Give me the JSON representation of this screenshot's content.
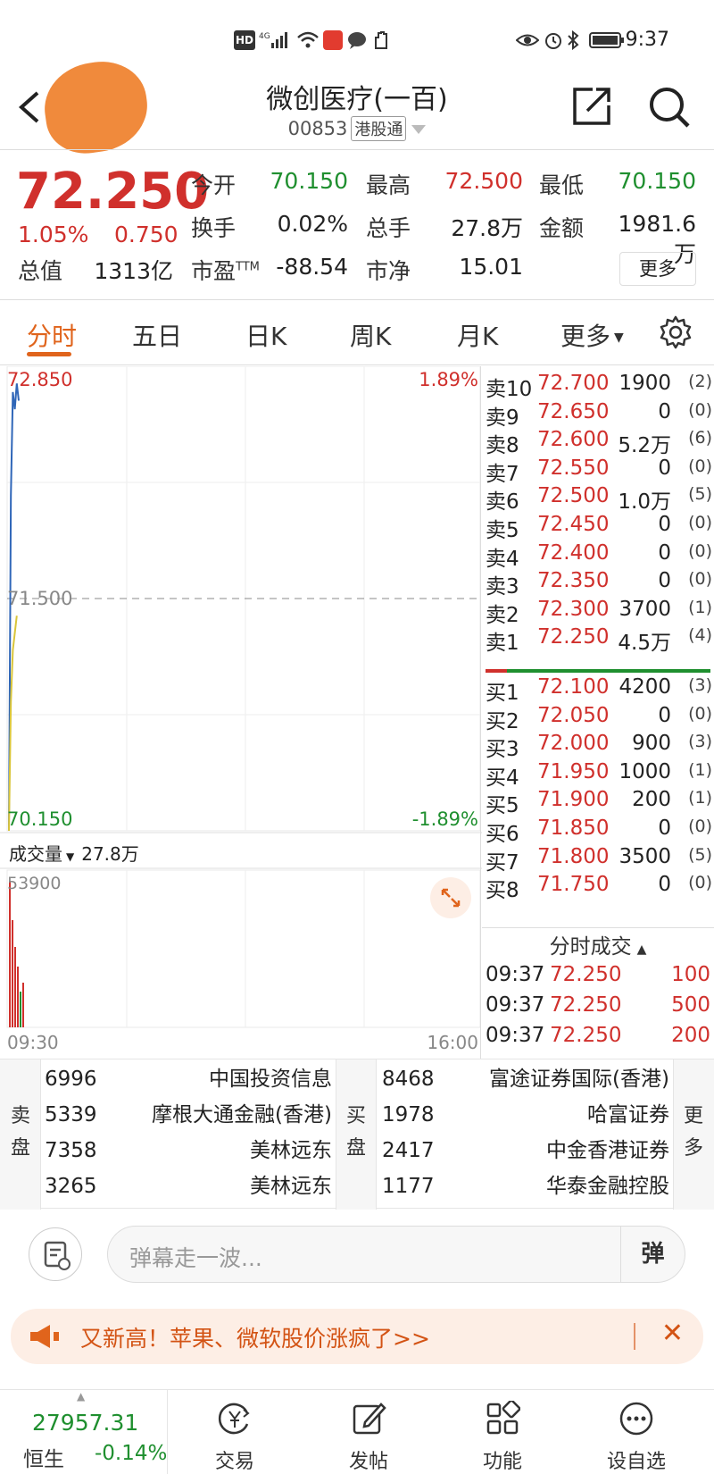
{
  "status_bar": {
    "time": "9:37",
    "network": "4G",
    "hd": "HD",
    "icons": [
      "hd-icon",
      "signal-icon",
      "wifi-icon",
      "app-icon",
      "chat-icon",
      "hand-icon",
      "eye-icon",
      "alarm-icon",
      "bluetooth-icon",
      "battery-icon"
    ]
  },
  "header": {
    "title": "微创医疗(一百)",
    "code": "00853",
    "tag": "港股通"
  },
  "quote": {
    "price": "72.250",
    "change_pct": "1.05%",
    "change_abs": "0.750",
    "labels": {
      "open": "今开",
      "high": "最高",
      "low": "最低",
      "turnover_rate": "换手",
      "volume": "总手",
      "amount": "金额",
      "market_cap": "总值",
      "pe": "市盈",
      "pe_sup": "TTM",
      "pb": "市净"
    },
    "values": {
      "open": "70.150",
      "high": "72.500",
      "low": "70.150",
      "turnover_rate": "0.02%",
      "volume": "27.8万",
      "amount": "1981.6万",
      "market_cap": "1313亿",
      "pe": "-88.54",
      "pb": "15.01"
    },
    "more_button": "更多"
  },
  "tabs": [
    {
      "label": "分时",
      "active": true
    },
    {
      "label": "五日"
    },
    {
      "label": "日K"
    },
    {
      "label": "周K"
    },
    {
      "label": "月K"
    },
    {
      "label": "更多"
    }
  ],
  "chart": {
    "y_top": "72.850",
    "y_mid": "71.500",
    "y_bottom": "70.150",
    "pct_top": "1.89%",
    "pct_bottom": "-1.89%",
    "volume_label": "成交量",
    "volume_value": "27.8万",
    "volume_max": "53900",
    "time_start": "09:30",
    "time_end": "16:00"
  },
  "chart_data": {
    "type": "line",
    "ylim": [
      70.15,
      72.85
    ],
    "reference": 71.5,
    "series": [
      {
        "values": [
          70.15,
          72.1,
          72.7,
          72.6,
          72.75,
          72.65
        ]
      },
      {
        "values": [
          70.15,
          70.9,
          71.2,
          71.3,
          71.4
        ]
      }
    ]
  },
  "order_book": {
    "asks": [
      {
        "label": "卖10",
        "price": "72.700",
        "qty": "1900",
        "count": "(2)"
      },
      {
        "label": "卖9",
        "price": "72.650",
        "qty": "0",
        "count": "(0)"
      },
      {
        "label": "卖8",
        "price": "72.600",
        "qty": "5.2万",
        "count": "(6)"
      },
      {
        "label": "卖7",
        "price": "72.550",
        "qty": "0",
        "count": "(0)"
      },
      {
        "label": "卖6",
        "price": "72.500",
        "qty": "1.0万",
        "count": "(5)"
      },
      {
        "label": "卖5",
        "price": "72.450",
        "qty": "0",
        "count": "(0)"
      },
      {
        "label": "卖4",
        "price": "72.400",
        "qty": "0",
        "count": "(0)"
      },
      {
        "label": "卖3",
        "price": "72.350",
        "qty": "0",
        "count": "(0)"
      },
      {
        "label": "卖2",
        "price": "72.300",
        "qty": "3700",
        "count": "(1)"
      },
      {
        "label": "卖1",
        "price": "72.250",
        "qty": "4.5万",
        "count": "(4)"
      }
    ],
    "bids": [
      {
        "label": "买1",
        "price": "72.100",
        "qty": "4200",
        "count": "(3)"
      },
      {
        "label": "买2",
        "price": "72.050",
        "qty": "0",
        "count": "(0)"
      },
      {
        "label": "买3",
        "price": "72.000",
        "qty": "900",
        "count": "(3)"
      },
      {
        "label": "买4",
        "price": "71.950",
        "qty": "1000",
        "count": "(1)"
      },
      {
        "label": "买5",
        "price": "71.900",
        "qty": "200",
        "count": "(1)"
      },
      {
        "label": "买6",
        "price": "71.850",
        "qty": "0",
        "count": "(0)"
      },
      {
        "label": "买7",
        "price": "71.800",
        "qty": "3500",
        "count": "(5)"
      },
      {
        "label": "买8",
        "price": "71.750",
        "qty": "0",
        "count": "(0)"
      }
    ]
  },
  "ticks": {
    "title": "分时成交",
    "rows": [
      {
        "time": "09:37",
        "price": "72.250",
        "qty": "100"
      },
      {
        "time": "09:37",
        "price": "72.250",
        "qty": "500"
      },
      {
        "time": "09:37",
        "price": "72.250",
        "qty": "200"
      }
    ]
  },
  "brokers": {
    "sell_label_1": "卖",
    "sell_label_2": "盘",
    "buy_label_1": "买",
    "buy_label_2": "盘",
    "more_1": "更",
    "more_2": "多",
    "sell": [
      {
        "id": "6996",
        "name": "中国投资信息"
      },
      {
        "id": "5339",
        "name": "摩根大通金融(香港)"
      },
      {
        "id": "7358",
        "name": "美林远东"
      },
      {
        "id": "3265",
        "name": "美林远东"
      }
    ],
    "buy": [
      {
        "id": "8468",
        "name": "富途证券国际(香港)"
      },
      {
        "id": "1978",
        "name": "哈富证券"
      },
      {
        "id": "2417",
        "name": "中金香港证券"
      },
      {
        "id": "1177",
        "name": "华泰金融控股"
      }
    ]
  },
  "danmaku": {
    "placeholder": "弹幕走一波...",
    "button": "弹"
  },
  "banner": {
    "text": "又新高！苹果、微软股价涨疯了>>",
    "close": "✕"
  },
  "bottom_nav": {
    "index_value": "27957.31",
    "index_name": "恒生",
    "index_change": "-0.14%",
    "items": [
      {
        "label": "交易"
      },
      {
        "label": "发帖"
      },
      {
        "label": "功能"
      },
      {
        "label": "设自选"
      }
    ]
  },
  "colors": {
    "up": "#d0302c",
    "down": "#1f8f2f",
    "accent": "#e0641c"
  }
}
